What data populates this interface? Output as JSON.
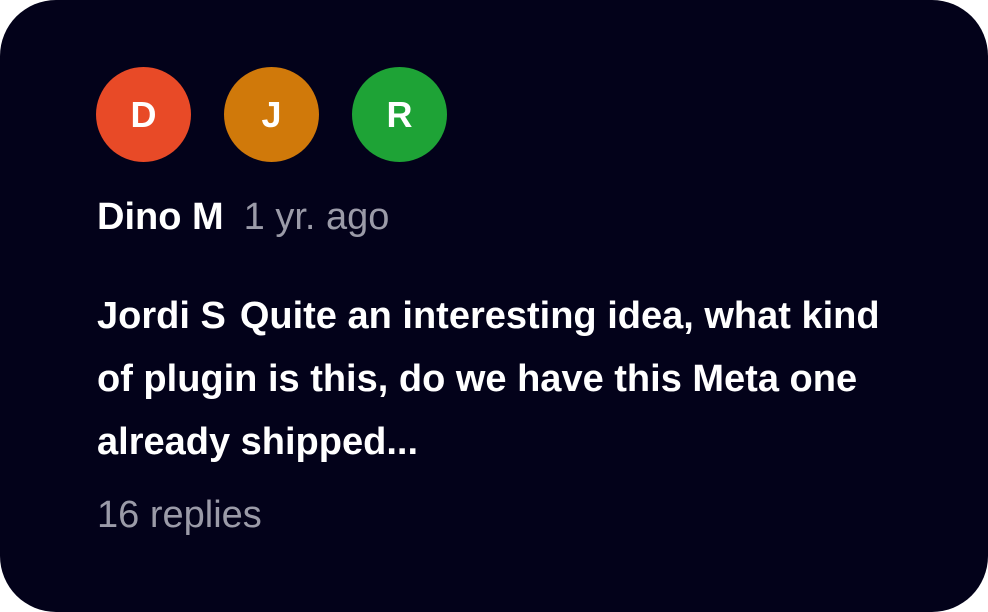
{
  "avatars": [
    {
      "initial": "D",
      "color": "#e84a27"
    },
    {
      "initial": "J",
      "color": "#d0790a"
    },
    {
      "initial": "R",
      "color": "#1ea336"
    }
  ],
  "thread": {
    "author": "Dino M",
    "time": "1 yr. ago",
    "reply_author": "Jordi S",
    "reply_text": "Quite an interesting idea, what kind of plugin is this, do we have this Meta one already shipped...",
    "replies_label": "16 replies"
  },
  "colors": {
    "card_background": "#03021a",
    "primary_text": "#ffffff",
    "secondary_text": "#9b9ba8"
  }
}
